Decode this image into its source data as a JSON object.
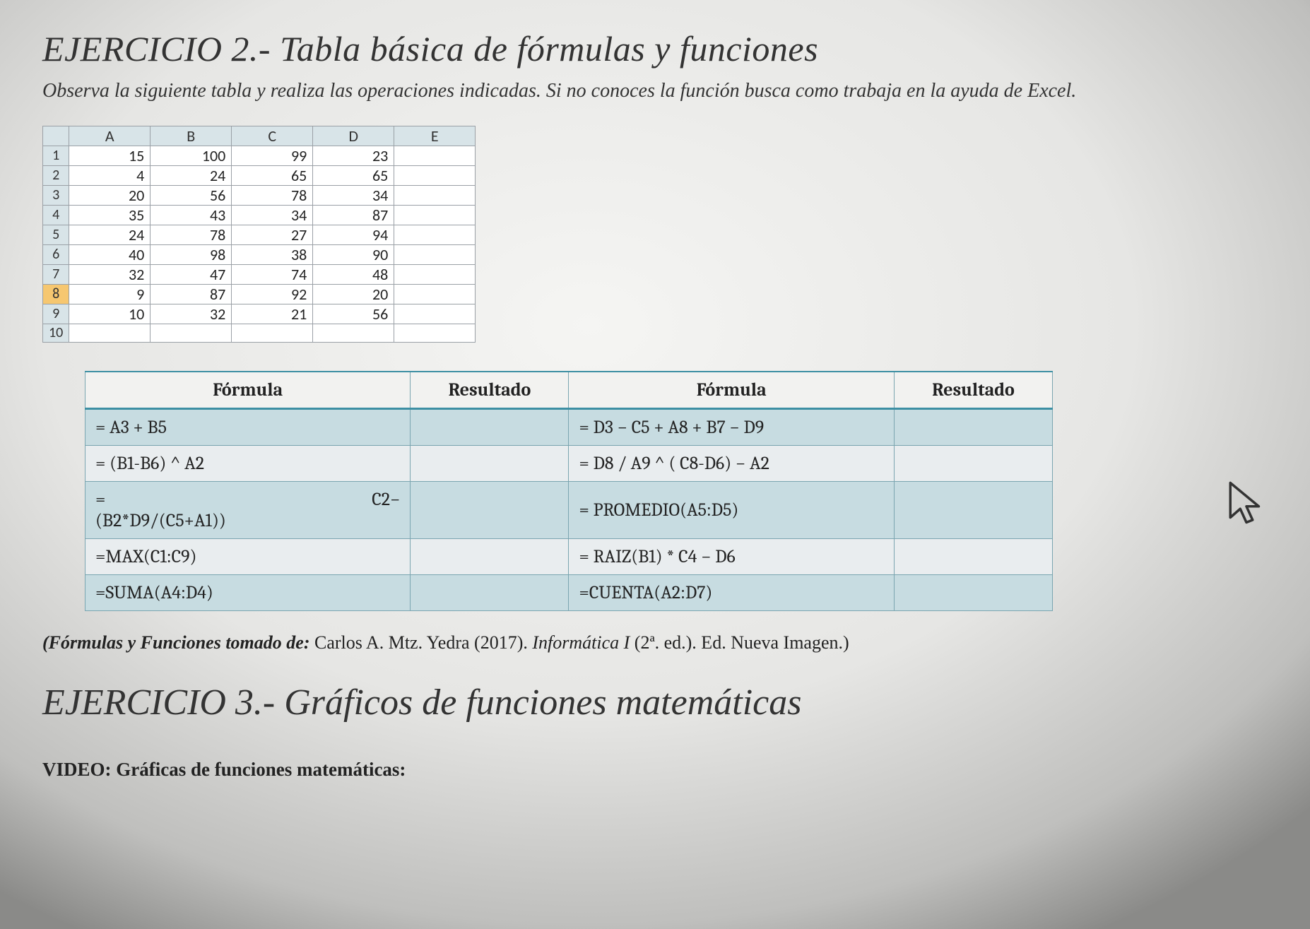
{
  "heading2": "EJERCICIO 2.- Tabla básica de fórmulas y funciones",
  "instruction": "Observa la siguiente tabla y realiza las operaciones indicadas. Si no conoces la función busca como trabaja en la ayuda de Excel.",
  "sheet": {
    "cols": [
      "A",
      "B",
      "C",
      "D",
      "E"
    ],
    "rows": [
      {
        "n": "1",
        "cells": [
          "15",
          "100",
          "99",
          "23",
          ""
        ]
      },
      {
        "n": "2",
        "cells": [
          "4",
          "24",
          "65",
          "65",
          ""
        ]
      },
      {
        "n": "3",
        "cells": [
          "20",
          "56",
          "78",
          "34",
          ""
        ]
      },
      {
        "n": "4",
        "cells": [
          "35",
          "43",
          "34",
          "87",
          ""
        ]
      },
      {
        "n": "5",
        "cells": [
          "24",
          "78",
          "27",
          "94",
          ""
        ]
      },
      {
        "n": "6",
        "cells": [
          "40",
          "98",
          "38",
          "90",
          ""
        ]
      },
      {
        "n": "7",
        "cells": [
          "32",
          "47",
          "74",
          "48",
          ""
        ]
      },
      {
        "n": "8",
        "cells": [
          "9",
          "87",
          "92",
          "20",
          ""
        ],
        "selected": true
      },
      {
        "n": "9",
        "cells": [
          "10",
          "32",
          "21",
          "56",
          ""
        ]
      },
      {
        "n": "10",
        "cells": [
          "",
          "",
          "",
          "",
          ""
        ]
      }
    ]
  },
  "ftable": {
    "headers": {
      "f1": "Fórmula",
      "r1": "Resultado",
      "f2": "Fórmula",
      "r2": "Resultado"
    },
    "rows": [
      {
        "alt": true,
        "f1": "= A3 + B5",
        "r1": "",
        "f2": "= D3 − C5 + A8 + B7 − D9",
        "r2": ""
      },
      {
        "alt": false,
        "f1": "= (B1-B6) ^ A2",
        "r1": "",
        "f2": "= D8 / A9 ^ ( C8-D6) − A2",
        "r2": ""
      },
      {
        "alt": true,
        "f1_a": "=",
        "f1_b": "C2−",
        "f1_c": "(B2*D9/(C5+A1))",
        "r1": "",
        "f2": "= PROMEDIO(A5:D5)",
        "r2": ""
      },
      {
        "alt": false,
        "f1": "=MAX(C1:C9)",
        "r1": "",
        "f2": "= RAIZ(B1) * C4 − D6",
        "r2": ""
      },
      {
        "alt": true,
        "f1": "=SUMA(A4:D4)",
        "r1": "",
        "f2": "=CUENTA(A2:D7)",
        "r2": ""
      }
    ]
  },
  "citation": {
    "lead": "(Fórmulas y Funciones  tomado de: ",
    "author": "Carlos A. Mtz. Yedra (2017).",
    "work": " Informática I ",
    "rest": " (2ª. ed.). Ed. Nueva Imagen.)"
  },
  "heading3": "EJERCICIO 3.- Gráficos de funciones matemáticas",
  "video_label": "VIDEO: Gráficas de funciones matemáticas:"
}
